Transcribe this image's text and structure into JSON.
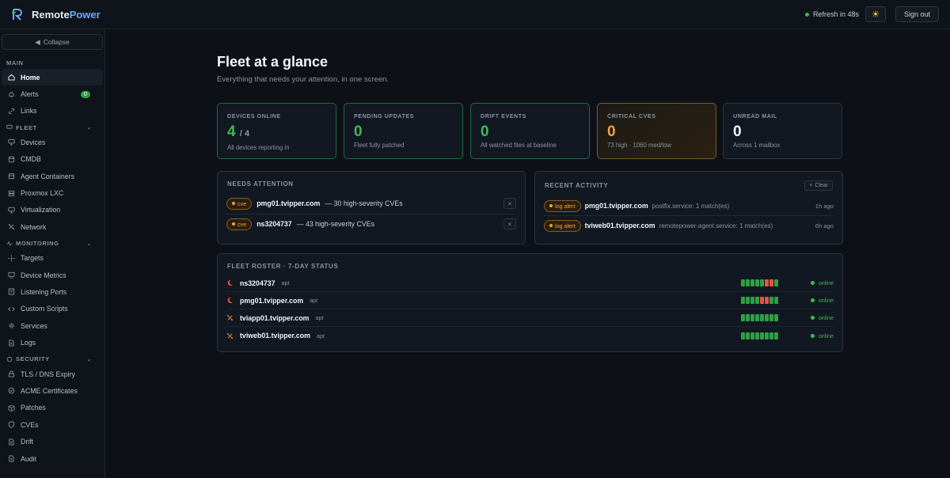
{
  "app": {
    "brand_prefix": "Remote",
    "brand_suffix": "Power"
  },
  "header": {
    "refresh": "Refresh in 48s",
    "theme_icon": "sun-icon",
    "signout": "Sign out"
  },
  "sidebar": {
    "collapse": "Collapse",
    "sections": [
      {
        "label": "MAIN",
        "items": [
          {
            "label": "Home",
            "icon": "home-icon",
            "active": true
          },
          {
            "label": "Alerts",
            "icon": "bell-icon",
            "badge": "0"
          },
          {
            "label": "Links",
            "icon": "link-icon"
          }
        ]
      },
      {
        "label": "FLEET",
        "items": [
          {
            "label": "Devices",
            "icon": "monitor-icon"
          },
          {
            "label": "CMDB",
            "icon": "database-icon"
          },
          {
            "label": "Agent Containers",
            "icon": "box-icon"
          },
          {
            "label": "Proxmox LXC",
            "icon": "server-icon"
          },
          {
            "label": "Virtualization",
            "icon": "monitor-icon"
          },
          {
            "label": "Network",
            "icon": "network-icon"
          }
        ]
      },
      {
        "label": "MONITORING",
        "items": [
          {
            "label": "Targets",
            "icon": "target-icon"
          },
          {
            "label": "Device Metrics",
            "icon": "chart-icon"
          },
          {
            "label": "Listening Ports",
            "icon": "list-icon"
          },
          {
            "label": "Custom Scripts",
            "icon": "code-icon"
          },
          {
            "label": "Services",
            "icon": "gear-icon"
          },
          {
            "label": "Logs",
            "icon": "file-icon"
          }
        ]
      },
      {
        "label": "SECURITY",
        "items": [
          {
            "label": "TLS / DNS Expiry",
            "icon": "lock-icon"
          },
          {
            "label": "ACME Certificates",
            "icon": "certificate-icon"
          },
          {
            "label": "Patches",
            "icon": "package-icon"
          },
          {
            "label": "CVEs",
            "icon": "shield-icon"
          },
          {
            "label": "Drift",
            "icon": "file-icon"
          },
          {
            "label": "Audit",
            "icon": "file-icon"
          }
        ]
      }
    ]
  },
  "main": {
    "title": "Fleet at a glance",
    "subtitle": "Everything that needs your attention, in one screen.",
    "kpis": [
      {
        "label": "DEVICES ONLINE",
        "value": "4",
        "sub": "/ 4",
        "note": "All devices reporting in"
      },
      {
        "label": "PENDING UPDATES",
        "value": "0",
        "note": "Fleet fully patched"
      },
      {
        "label": "DRIFT EVENTS",
        "value": "0",
        "note": "All watched files at baseline"
      },
      {
        "label": "CRITICAL CVES",
        "value": "0",
        "note": "73 high · 1060 med/low"
      },
      {
        "label": "UNREAD MAIL",
        "value": "0",
        "note": "Across 1 mailbox"
      }
    ],
    "attention": {
      "title": "NEEDS ATTENTION",
      "items": [
        {
          "tag": "cve",
          "host": "pmg01.tvipper.com",
          "text": "— 30 high-severity CVEs",
          "dismiss": "×"
        },
        {
          "tag": "cve",
          "host": "ns3204737",
          "text": "— 43 high-severity CVEs",
          "dismiss": "×"
        }
      ]
    },
    "activity": {
      "title": "RECENT ACTIVITY",
      "clear": "Clear",
      "items": [
        {
          "tag": "log alert",
          "host": "pmg01.tvipper.com",
          "detail": "postfix.service: 1 match(es)",
          "time": "1h ago"
        },
        {
          "tag": "log alert",
          "host": "tviweb01.tvipper.com",
          "detail": "remotepower-agent.service: 1 match(es)",
          "time": "6h ago"
        }
      ]
    },
    "roster": {
      "title": "FLEET ROSTER · 7-DAY STATUS",
      "rows": [
        {
          "host": "ns3204737",
          "pkg": "apt",
          "os_icon": "moon-icon",
          "os_color": "#e5534b",
          "status": "online",
          "days": [
            1,
            1,
            1,
            1,
            1,
            0,
            0,
            1
          ]
        },
        {
          "host": "pmg01.tvipper.com",
          "pkg": "apt",
          "os_icon": "moon-icon",
          "os_color": "#e5534b",
          "status": "online",
          "days": [
            1,
            1,
            1,
            1,
            0,
            0,
            1,
            1
          ]
        },
        {
          "host": "tviapp01.tvipper.com",
          "pkg": "apt",
          "os_icon": "network-icon",
          "os_color": "#f0883e",
          "status": "online",
          "days": [
            1,
            1,
            1,
            1,
            1,
            1,
            1,
            1
          ]
        },
        {
          "host": "tviweb01.tvipper.com",
          "pkg": "apt",
          "os_icon": "network-icon",
          "os_color": "#f0883e",
          "status": "online",
          "days": [
            1,
            1,
            1,
            1,
            1,
            1,
            1,
            1
          ]
        }
      ]
    }
  }
}
